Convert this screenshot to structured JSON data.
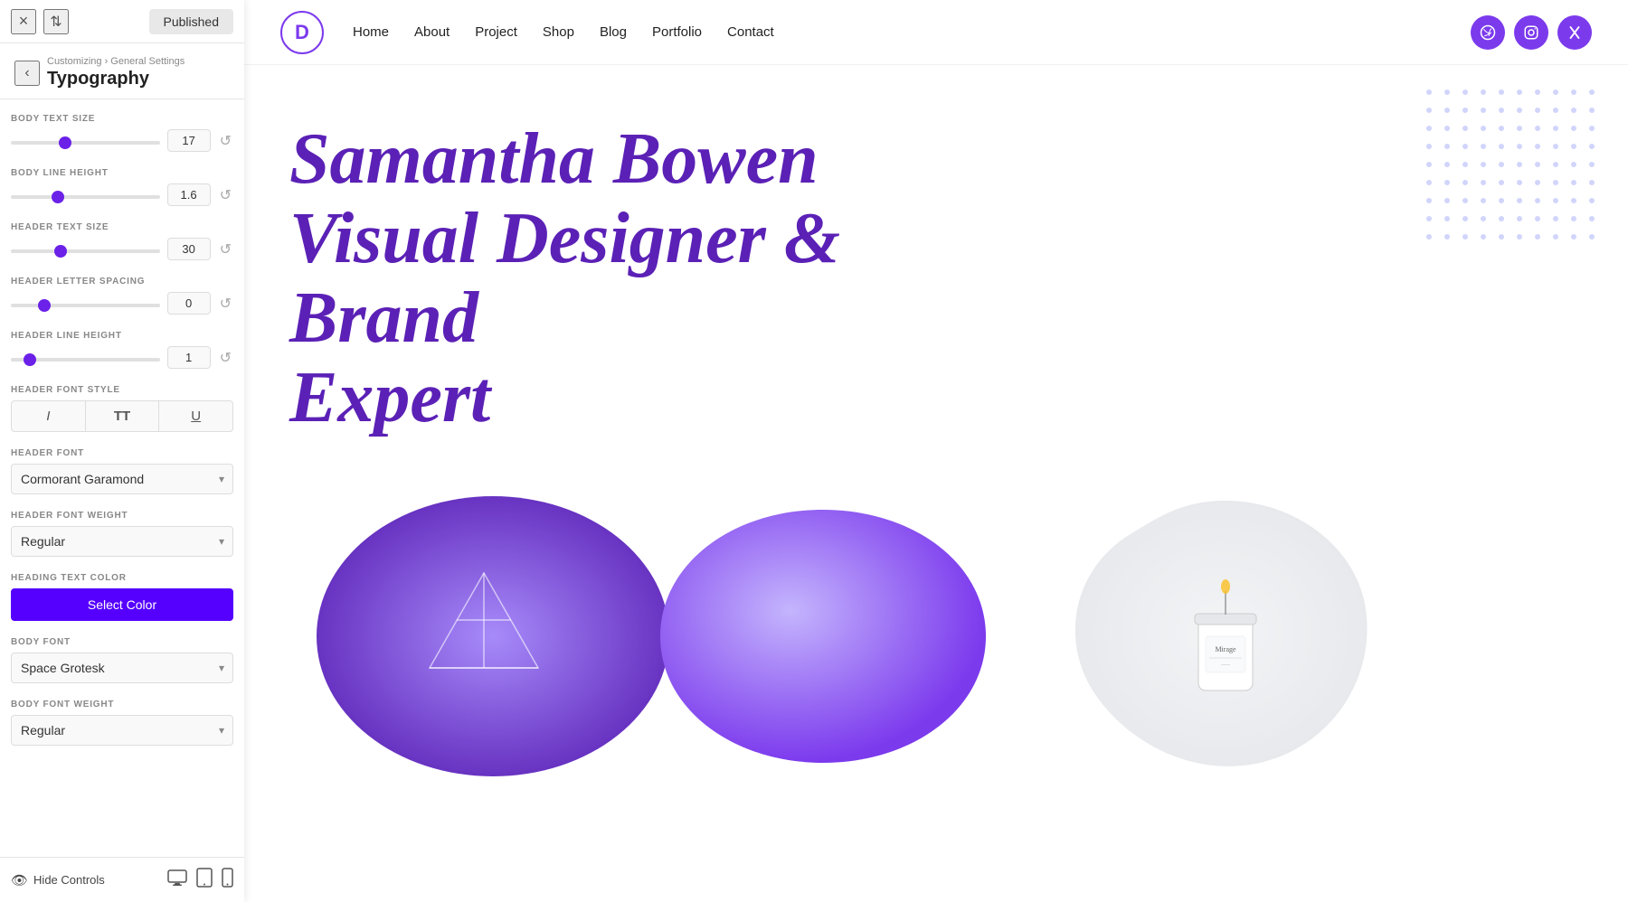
{
  "topbar": {
    "close_icon": "×",
    "swap_icon": "⇅",
    "published_label": "Published"
  },
  "panel": {
    "back_icon": "‹",
    "breadcrumb": "Customizing › General Settings",
    "title": "Typography",
    "controls": {
      "body_text_size_label": "BODY TEXT SIZE",
      "body_text_size_value": "17",
      "body_line_height_label": "BODY LINE HEIGHT",
      "body_line_height_value": "1.6",
      "header_text_size_label": "HEADER TEXT SIZE",
      "header_text_size_value": "30",
      "header_letter_spacing_label": "HEADER LETTER SPACING",
      "header_letter_spacing_value": "0",
      "header_line_height_label": "HEADER LINE HEIGHT",
      "header_line_height_value": "1",
      "header_font_style_label": "HEADER FONT STYLE",
      "font_style_italic": "I",
      "font_style_bold": "TT",
      "font_style_underline": "U",
      "header_font_label": "HEADER FONT",
      "header_font_value": "Cormorant Garamond",
      "header_font_weight_label": "HEADER FONT WEIGHT",
      "header_font_weight_value": "Regular",
      "heading_text_color_label": "HEADING TEXT COLOR",
      "select_color_label": "Select Color",
      "body_font_label": "BODY FONT",
      "body_font_value": "Space Grotesk",
      "body_font_weight_label": "BODY FONT WEIGHT",
      "body_font_weight_value": "Regular"
    }
  },
  "bottom_toolbar": {
    "hide_controls_label": "Hide Controls",
    "desktop_icon": "🖥",
    "tablet_icon": "▭",
    "mobile_icon": "📱"
  },
  "preview": {
    "nav": {
      "logo_letter": "D",
      "links": [
        "Home",
        "About",
        "Project",
        "Shop",
        "Blog",
        "Portfolio",
        "Contact"
      ]
    },
    "hero": {
      "line1": "Samantha Bowen",
      "line2": "Visual Designer & Brand",
      "line3": "Expert"
    },
    "images": {
      "candle_label": "Mirage"
    }
  }
}
